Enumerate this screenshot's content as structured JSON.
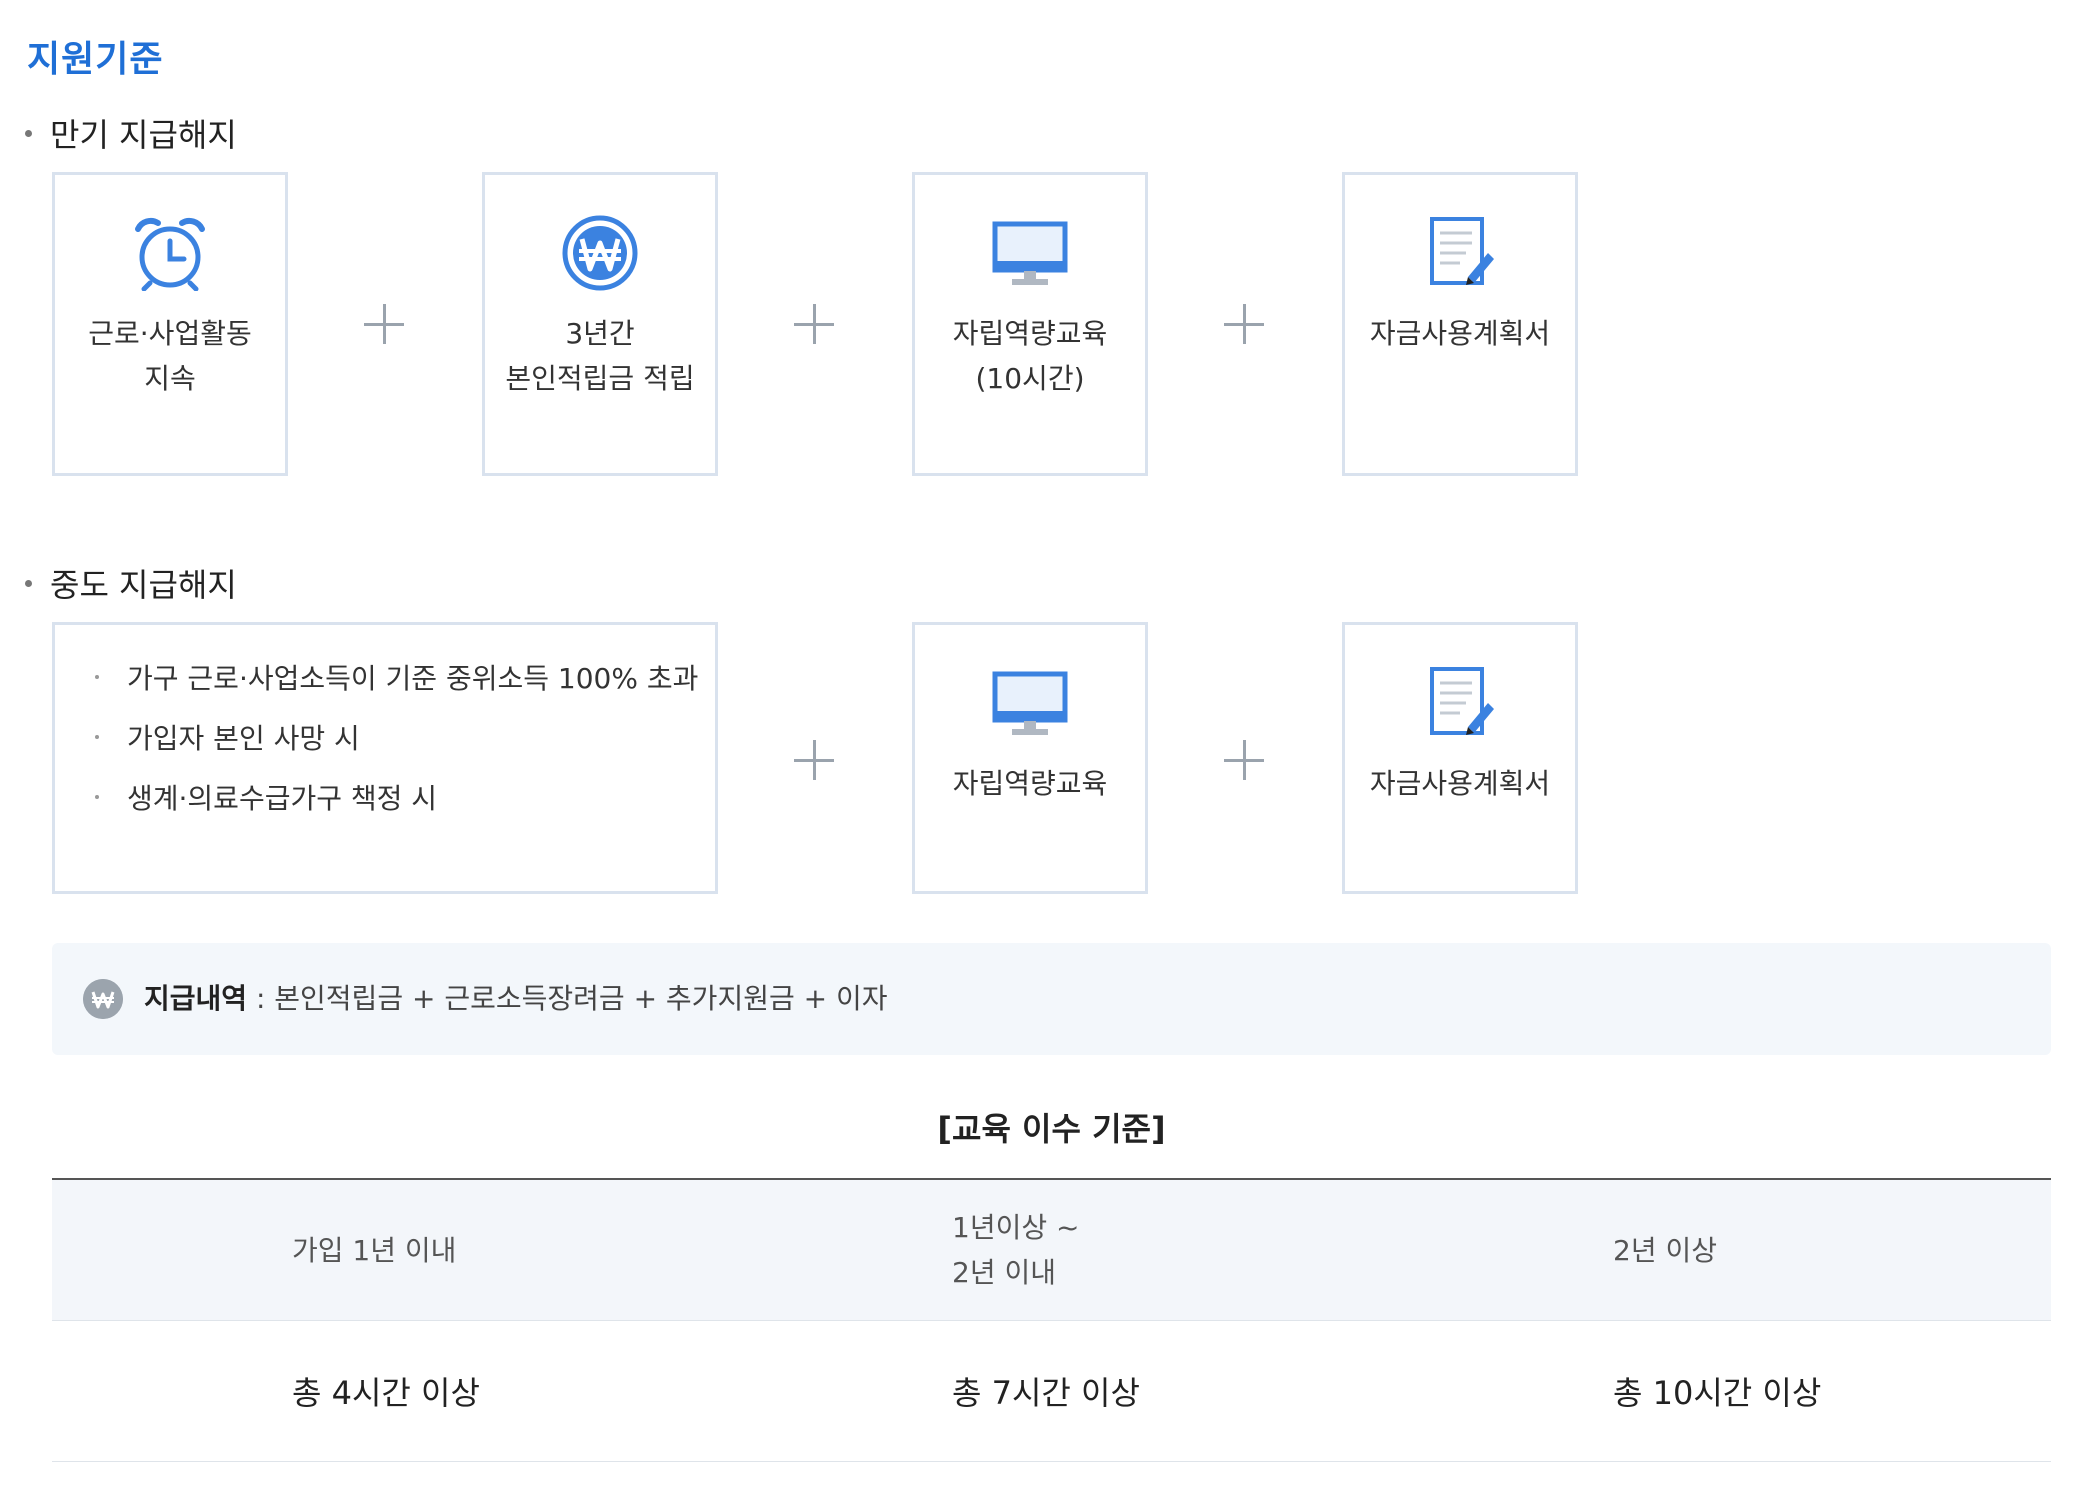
{
  "section_title": "지원기준",
  "maturity": {
    "heading": "만기 지급해지",
    "items": [
      {
        "icon": "alarm-clock-icon",
        "line1": "근로·사업활동",
        "line2": "지속"
      },
      {
        "icon": "won-coin-icon",
        "line1": "3년간",
        "line2": "본인적립금 적립"
      },
      {
        "icon": "monitor-icon",
        "line1": "자립역량교육",
        "line2": "(10시간)"
      },
      {
        "icon": "document-pencil-icon",
        "line1": "자금사용계획서",
        "line2": ""
      }
    ]
  },
  "midterm": {
    "heading": "중도 지급해지",
    "conditions": [
      "가구 근로·사업소득이 기준 중위소득 100% 초과",
      "가입자 본인 사망 시",
      "생계·의료수급가구 책정 시"
    ],
    "items": [
      {
        "icon": "monitor-icon",
        "line1": "자립역량교육"
      },
      {
        "icon": "document-pencil-icon",
        "line1": "자금사용계획서"
      }
    ]
  },
  "payment": {
    "label": "지급내역",
    "separator": " : ",
    "value": "본인적립금 + 근로소득장려금 + 추가지원금 + 이자"
  },
  "education": {
    "title": "[교육 이수 기준]",
    "headers": [
      {
        "line1": "가입 1년 이내",
        "line2": ""
      },
      {
        "line1": "1년이상 ~",
        "line2": "2년 이내"
      },
      {
        "line1": "2년 이상",
        "line2": ""
      }
    ],
    "values": [
      "총 4시간 이상",
      "총 7시간 이상",
      "총 10시간 이상"
    ]
  },
  "colors": {
    "accent": "#1f6fd6",
    "icon_blue": "#3b82e0",
    "box_border": "#d9e2ee",
    "panel_bg": "#f3f7fb"
  }
}
